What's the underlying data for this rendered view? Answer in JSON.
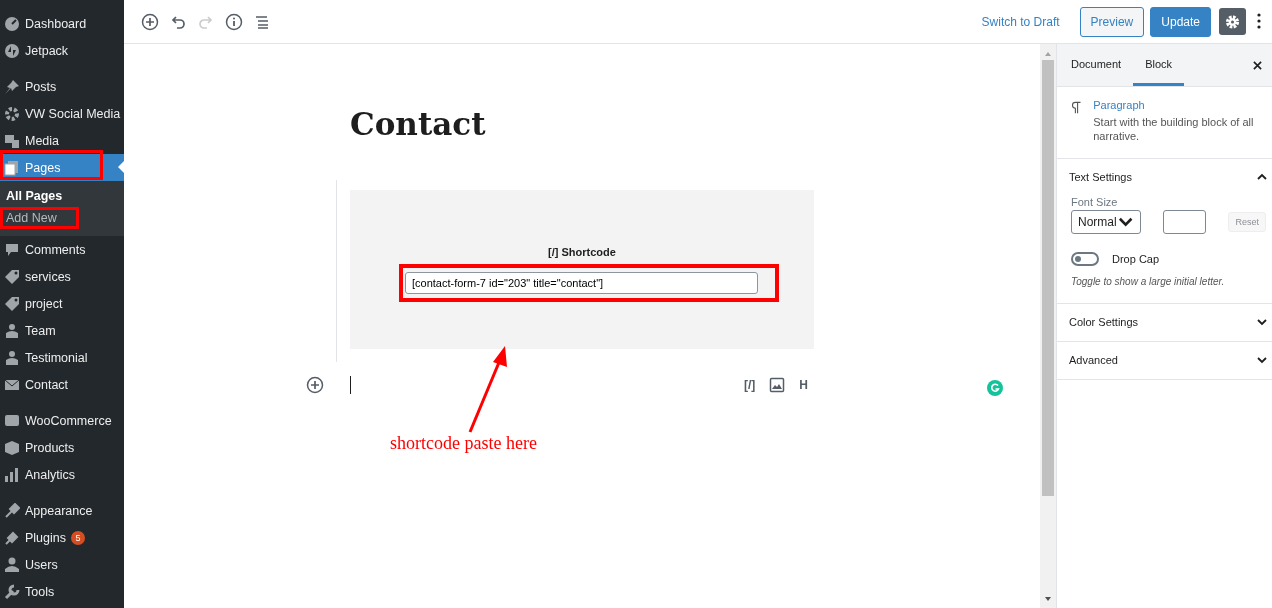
{
  "sidebar": {
    "groups": [
      {
        "items": [
          {
            "label": "Dashboard",
            "selected": false,
            "highlighted": false
          },
          {
            "label": "Jetpack",
            "selected": false,
            "highlighted": false
          }
        ]
      },
      {
        "items": [
          {
            "label": "Posts",
            "selected": false,
            "highlighted": false
          },
          {
            "label": "VW Social Media",
            "selected": false,
            "highlighted": false
          },
          {
            "label": "Media",
            "selected": false,
            "highlighted": false
          },
          {
            "label": "Pages",
            "selected": true,
            "highlighted": true,
            "children": [
              {
                "label": "All Pages",
                "selected": true,
                "highlighted": false
              },
              {
                "label": "Add New",
                "selected": false,
                "highlighted": true
              }
            ]
          },
          {
            "label": "Comments",
            "selected": false,
            "highlighted": false
          },
          {
            "label": "services",
            "selected": false,
            "highlighted": false
          },
          {
            "label": "project",
            "selected": false,
            "highlighted": false
          },
          {
            "label": "Team",
            "selected": false,
            "highlighted": false
          },
          {
            "label": "Testimonial",
            "selected": false,
            "highlighted": false
          },
          {
            "label": "Contact",
            "selected": false,
            "highlighted": false
          }
        ]
      },
      {
        "items": [
          {
            "label": "WooCommerce",
            "selected": false,
            "highlighted": false
          },
          {
            "label": "Products",
            "selected": false,
            "highlighted": false
          },
          {
            "label": "Analytics",
            "selected": false,
            "highlighted": false
          }
        ]
      },
      {
        "items": [
          {
            "label": "Appearance",
            "selected": false,
            "highlighted": false
          },
          {
            "label": "Plugins",
            "selected": false,
            "highlighted": false,
            "badge": "5"
          },
          {
            "label": "Users",
            "selected": false,
            "highlighted": false
          },
          {
            "label": "Tools",
            "selected": false,
            "highlighted": false
          }
        ]
      }
    ]
  },
  "toolbar": {
    "tools": [
      {
        "kind": "add",
        "disabled": false
      },
      {
        "kind": "undo",
        "disabled": false
      },
      {
        "kind": "redo",
        "disabled": true
      },
      {
        "kind": "info",
        "disabled": false
      },
      {
        "kind": "outline",
        "disabled": false
      }
    ],
    "switch_link": "Switch to Draft",
    "preview": "Preview",
    "update": "Update",
    "settings_pressed": true
  },
  "editor": {
    "title": "Contact",
    "block": {
      "icon": "[/]",
      "label": "Shortcode",
      "value": "[contact-form-7 id=\"203\" title=\"contact\"]",
      "highlighted": true
    },
    "inserter_tools": [
      {
        "kind": "shortcode",
        "text": "[/]"
      },
      {
        "kind": "image"
      },
      {
        "kind": "heading",
        "text": "H"
      }
    ],
    "annotation": "shortcode paste here"
  },
  "panel": {
    "tabs": [
      {
        "label": "Document",
        "selected": false
      },
      {
        "label": "Block",
        "selected": true
      }
    ],
    "block_card": {
      "title": "Paragraph",
      "description": "Start with the building block of all narrative."
    },
    "sections": [
      {
        "title": "Text Settings",
        "expanded": true,
        "font_size_label": "Font Size",
        "font_size": "Normal",
        "reset": {
          "label": "Reset",
          "disabled": true
        },
        "drop_cap": {
          "label": "Drop Cap",
          "on": false,
          "help": "Toggle to show a large initial letter."
        }
      },
      {
        "title": "Color Settings",
        "expanded": false
      },
      {
        "title": "Advanced",
        "expanded": false
      }
    ]
  }
}
